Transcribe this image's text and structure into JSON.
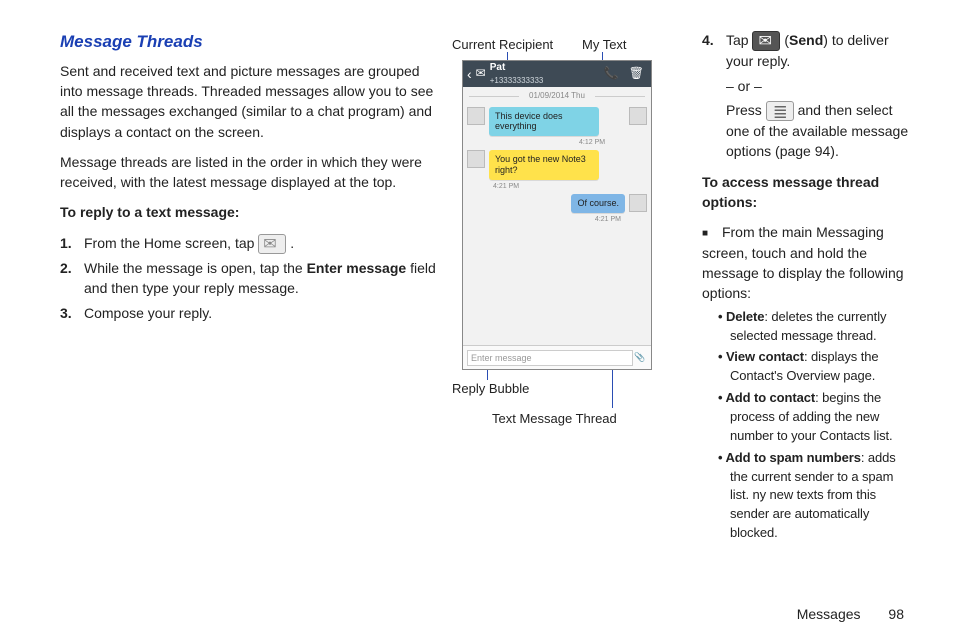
{
  "heading": "Message Threads",
  "para1": "Sent and received text and picture messages are grouped into message threads. Threaded messages allow you to see all the messages exchanged (similar to a chat program) and displays a contact on the screen.",
  "para2": "Message threads are listed in the order in which they were received, with the latest message displayed at the top.",
  "reply_heading": "To reply to a text message:",
  "step1_a": "From the Home screen, tap ",
  "step1_b": " .",
  "step2_a": "While the message is open, tap the ",
  "step2_bold": "Enter message",
  "step2_b": " field and then type your reply message.",
  "step3": "Compose your reply.",
  "step4_a": "Tap ",
  "step4_send_label": " (",
  "step4_send_bold": "Send",
  "step4_b": ") to deliver your reply.",
  "or_line": "– or –",
  "press_a": "Press ",
  "press_b": " and then select one of the available message options (page 94).",
  "access_heading": "To access message thread options:",
  "access_intro": "From the main Messaging screen, touch and hold the message to display the following options:",
  "opts": [
    {
      "t": "Delete",
      "d": ": deletes the currently selected message thread."
    },
    {
      "t": "View contact",
      "d": ": displays the Contact's Overview page."
    },
    {
      "t": "Add to contact",
      "d": ": begins the process of adding the new number to your Contacts list."
    },
    {
      "t": "Add to spam numbers",
      "d": ": adds the current sender to a spam list. ny new texts from this sender are automatically blocked."
    }
  ],
  "labels": {
    "current_recipient": "Current Recipient",
    "my_text": "My Text",
    "reply_bubble": "Reply Bubble",
    "text_thread": "Text Message Thread"
  },
  "phone": {
    "name": "Pat",
    "number": "+13333333333",
    "date": "01/09/2014 Thu",
    "msg1": "This device does everything",
    "time1": "4:12 PM",
    "msg2": "You got the new Note3 right?",
    "time2": "4:21 PM",
    "msg3": "Of course.",
    "time3": "4:21 PM",
    "placeholder": "Enter message"
  },
  "footer_section": "Messages",
  "footer_page": "98"
}
